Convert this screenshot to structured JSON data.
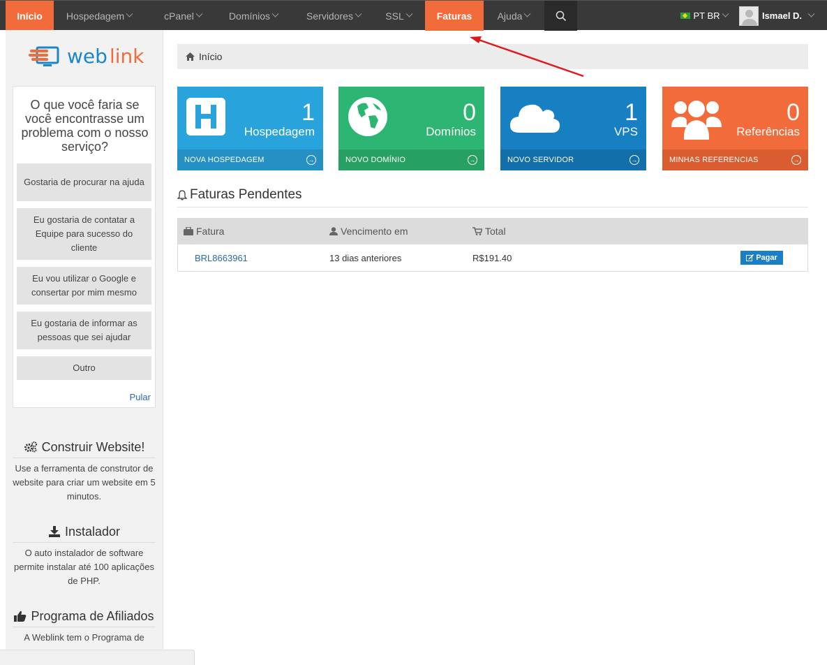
{
  "nav": {
    "items": [
      {
        "label": "Início",
        "active": true,
        "dropdown": false
      },
      {
        "label": "Hospedagem",
        "active": false,
        "dropdown": true
      },
      {
        "label": "cPanel",
        "active": false,
        "dropdown": true
      },
      {
        "label": "Domínios",
        "active": false,
        "dropdown": true
      },
      {
        "label": "Servidores",
        "active": false,
        "dropdown": true
      },
      {
        "label": "SSL",
        "active": false,
        "dropdown": true
      },
      {
        "label": "Faturas",
        "active": true,
        "dropdown": false
      },
      {
        "label": "Ajuda",
        "active": false,
        "dropdown": true
      }
    ],
    "language": "PT BR",
    "user": "Ismael D."
  },
  "brand": {
    "logo_text": "weblink",
    "accent": "#f26b3a"
  },
  "survey": {
    "question": "O que você faria se você encontrasse um problema com o nosso serviço?",
    "options": [
      "Gostaria de procurar na ajuda",
      "Eu gostaria de contatar a Equipe para sucesso do cliente",
      "Eu vou utilizar o Google e consertar por mim mesmo",
      "Eu gostaria de informar as pessoas que sei ajudar",
      "Outro"
    ],
    "skip": "Pular"
  },
  "sidebar_sections": [
    {
      "title": "Construir Website!",
      "icon": "gears-icon",
      "text": "Use a ferramenta de construtor de website para criar um website em 5 minutos."
    },
    {
      "title": "Instalador",
      "icon": "download-icon",
      "text": "O auto instalador de software permite instalar até 100 aplicações de PHP."
    },
    {
      "title": "Programa de Afiliados",
      "icon": "thumbs-up-icon",
      "text": "A Weblink tem o Programa de"
    }
  ],
  "breadcrumb": "Início",
  "tiles": [
    {
      "count": "1",
      "label": "Hospedagem",
      "action": "NOVA HOSPEDAGEM",
      "color": "#29a3dc",
      "foot_color": "#2590c3",
      "icon": "hosting-h-icon"
    },
    {
      "count": "0",
      "label": "Domínios",
      "action": "NOVO DOMÍNIO",
      "color": "#2cb573",
      "foot_color": "#27a064",
      "icon": "globe-icon"
    },
    {
      "count": "1",
      "label": "VPS",
      "action": "NOVO SERVIDOR",
      "color": "#1780c3",
      "foot_color": "#136fa9",
      "icon": "cloud-icon"
    },
    {
      "count": "0",
      "label": "Referências",
      "action": "MINHAS REFERENCIAS",
      "color": "#f26b3a",
      "foot_color": "#d95d30",
      "icon": "users-icon"
    }
  ],
  "invoices": {
    "title": "Faturas Pendentes",
    "columns": [
      "Fatura",
      "Vencimento em",
      "Total"
    ],
    "rows": [
      {
        "id": "BRL8663961",
        "due": "13 dias anteriores",
        "total": "R$191.40",
        "action": "Pagar"
      }
    ]
  }
}
